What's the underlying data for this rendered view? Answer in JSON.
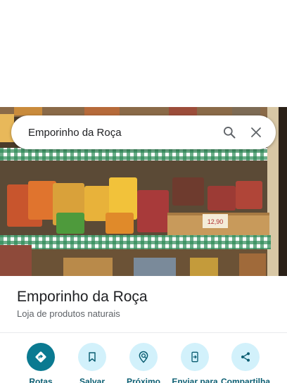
{
  "search": {
    "query": "Emporinho da Roça"
  },
  "place": {
    "name": "Emporinho da Roça",
    "category": "Loja de produtos naturais",
    "price_tag": "12,90"
  },
  "actions": [
    {
      "label": "Rotas",
      "icon": "directions-icon"
    },
    {
      "label": "Salvar",
      "icon": "bookmark-icon"
    },
    {
      "label": "Próximo",
      "icon": "nearby-icon"
    },
    {
      "label": "Enviar para",
      "icon": "send-to-phone-icon"
    },
    {
      "label": "Compartilha",
      "icon": "share-icon"
    }
  ],
  "colors": {
    "primary": "#0b7a91",
    "action_bg": "#d2f1fb",
    "label": "#0b5e72"
  }
}
